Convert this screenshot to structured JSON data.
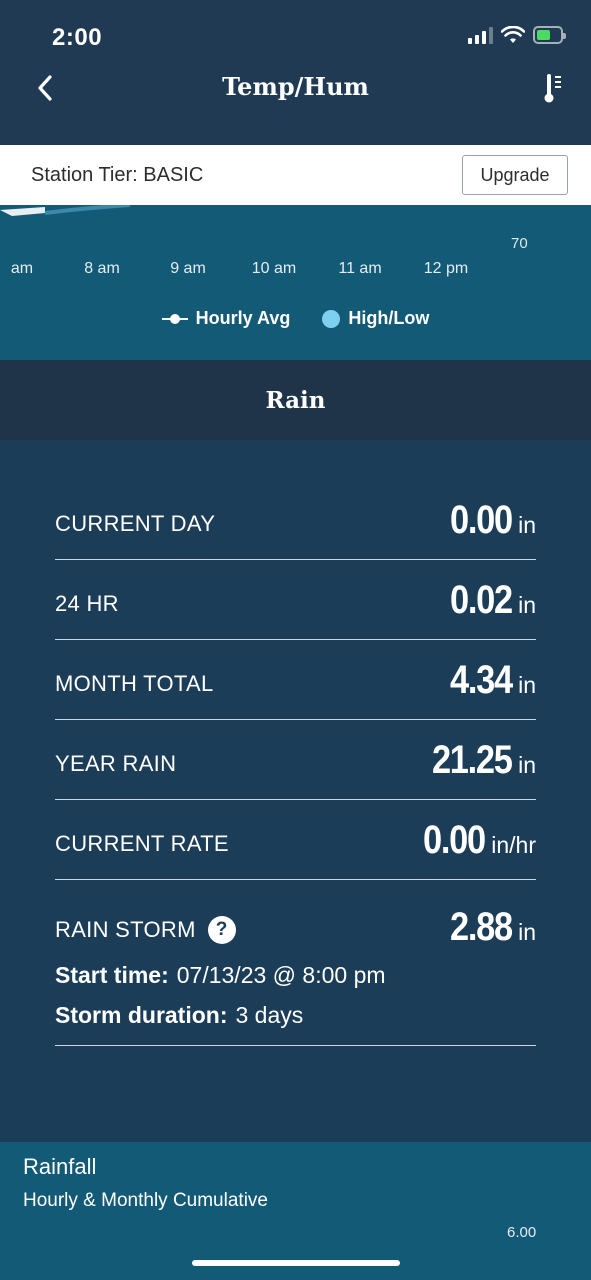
{
  "status_bar": {
    "time": "2:00"
  },
  "header": {
    "title": "Temp/Hum"
  },
  "tier": {
    "label": "Station Tier: BASIC",
    "upgrade_label": "Upgrade"
  },
  "temp_chart": {
    "y_tick": "70",
    "x_ticks": [
      "am",
      "8 am",
      "9 am",
      "10 am",
      "11 am",
      "12 pm"
    ],
    "legend": {
      "avg": "Hourly Avg",
      "highlow": "High/Low"
    },
    "colors": {
      "avg": "#ffffff",
      "highlow": "#7fd0f0"
    }
  },
  "rain": {
    "title": "Rain",
    "rows": [
      {
        "label": "CURRENT DAY",
        "value": "0.00",
        "unit": "in"
      },
      {
        "label": "24 HR",
        "value": "0.02",
        "unit": "in"
      },
      {
        "label": "MONTH TOTAL",
        "value": "4.34",
        "unit": "in"
      },
      {
        "label": "YEAR RAIN",
        "value": "21.25",
        "unit": "in"
      },
      {
        "label": "CURRENT RATE",
        "value": "0.00",
        "unit": "in/hr"
      }
    ],
    "storm": {
      "label": "RAIN STORM",
      "value": "2.88",
      "unit": "in",
      "start_label": "Start time:",
      "start_value": "07/13/23 @ 8:00 pm",
      "duration_label": "Storm duration:",
      "duration_value": "3 days"
    }
  },
  "rainfall": {
    "title": "Rainfall",
    "subtitle": "Hourly & Monthly Cumulative",
    "y_tick": "6.00"
  }
}
